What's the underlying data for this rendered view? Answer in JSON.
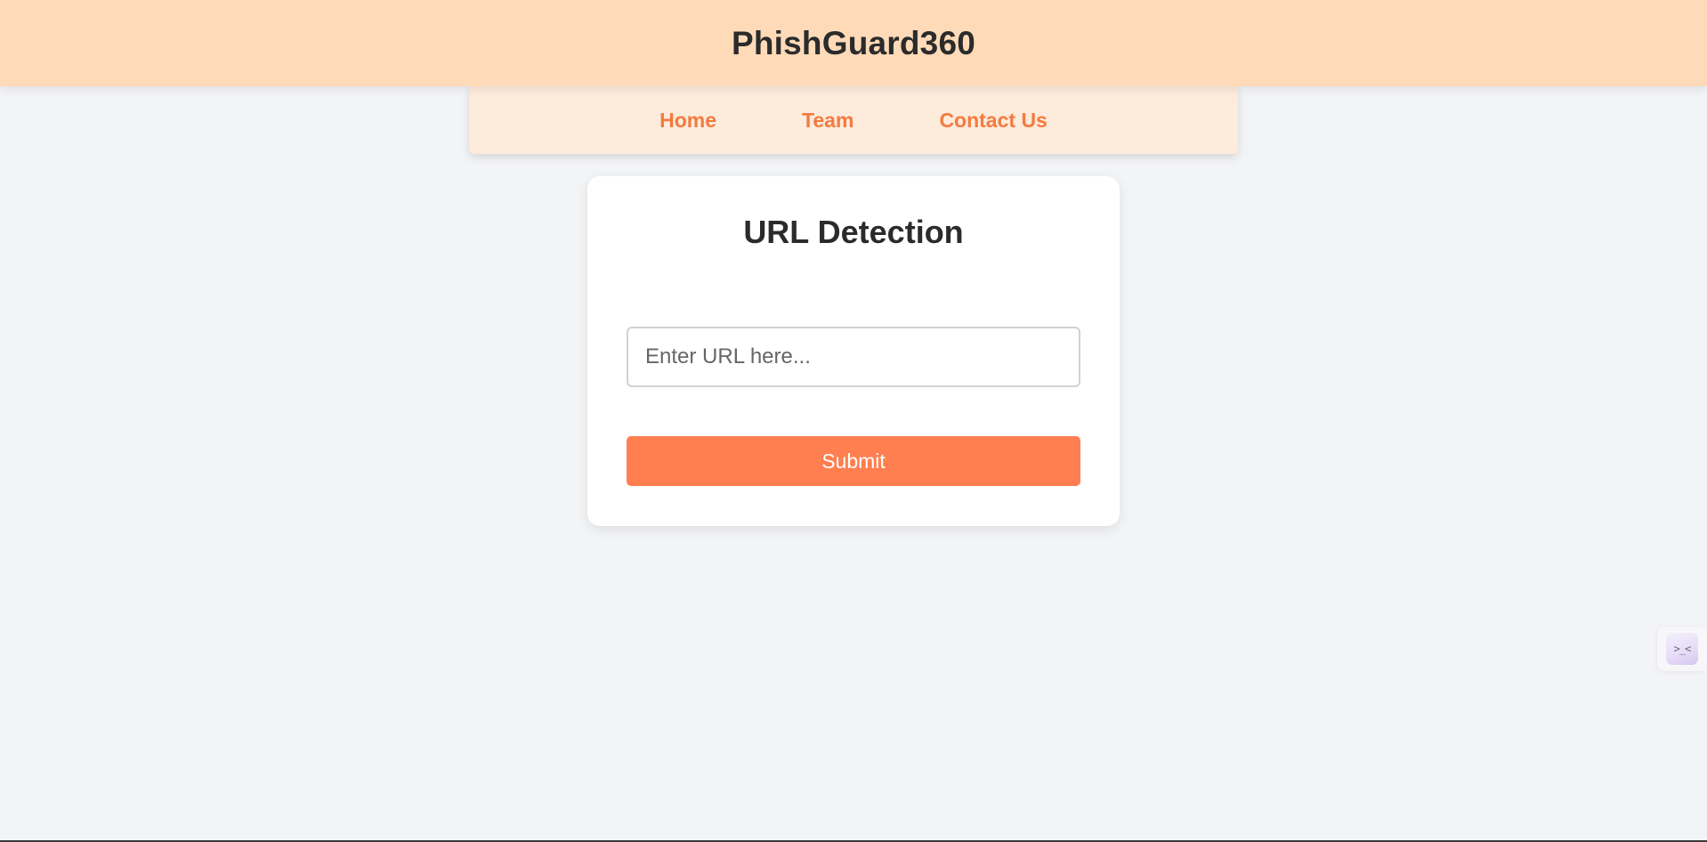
{
  "header": {
    "title": "PhishGuard360"
  },
  "nav": {
    "items": [
      {
        "label": "Home"
      },
      {
        "label": "Team"
      },
      {
        "label": "Contact Us"
      }
    ]
  },
  "detection": {
    "title": "URL Detection",
    "url_input": {
      "value": "",
      "placeholder": "Enter URL here..."
    },
    "submit_label": "Submit"
  },
  "widget": {
    "icon": "assistant-face-icon",
    "glyph": ">_<"
  },
  "colors": {
    "header_bg": "#ffdab8",
    "nav_bg": "#fdebdc",
    "accent": "#ff7f50",
    "nav_link": "#f47a3f",
    "page_bg": "#f3f4f6"
  }
}
